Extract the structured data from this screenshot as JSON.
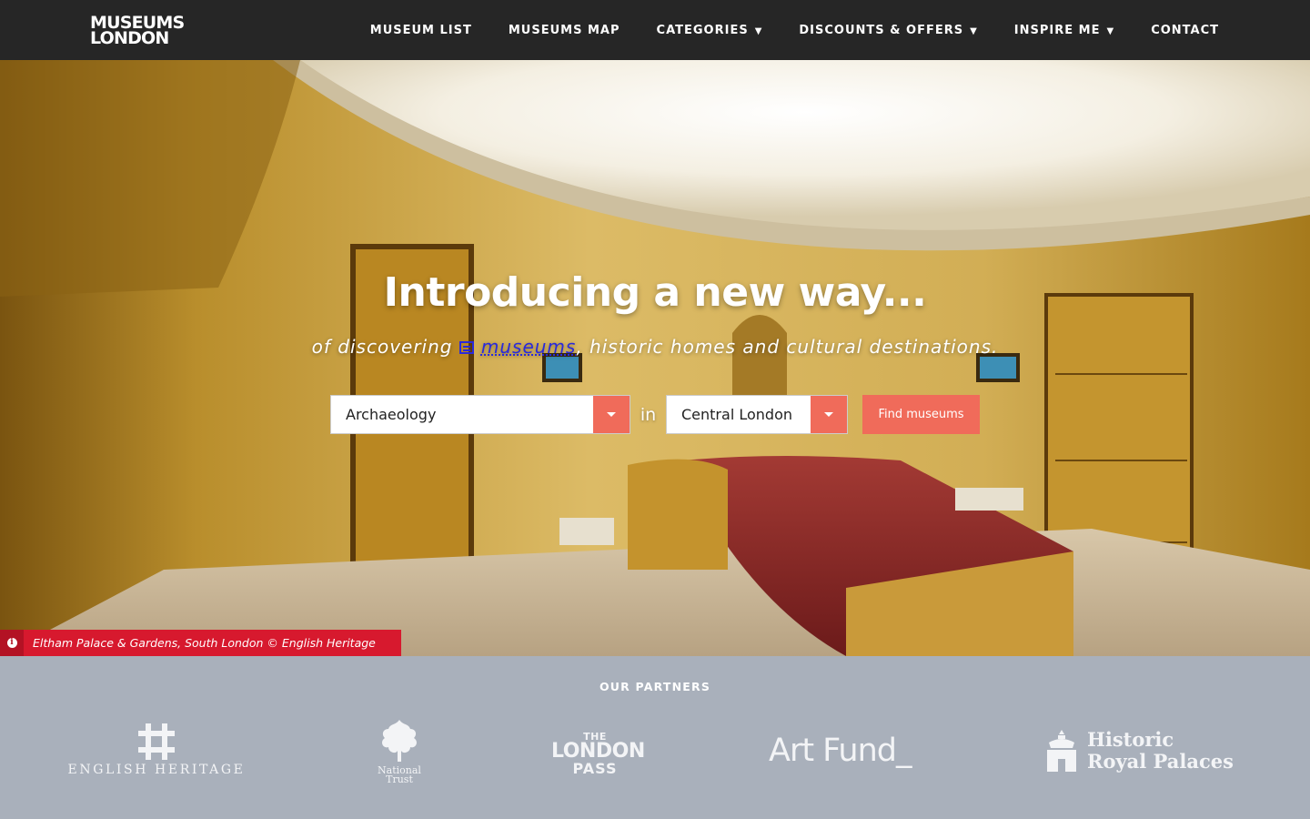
{
  "brand": {
    "logo_line1": "MUSEUMS",
    "logo_line2": "LONDON"
  },
  "nav": {
    "items": [
      {
        "label": "MUSEUM LIST",
        "has_dropdown": false
      },
      {
        "label": "MUSEUMS MAP",
        "has_dropdown": false
      },
      {
        "label": "CATEGORIES",
        "has_dropdown": true
      },
      {
        "label": "DISCOUNTS & OFFERS",
        "has_dropdown": true
      },
      {
        "label": "INSPIRE ME",
        "has_dropdown": true
      },
      {
        "label": "CONTACT",
        "has_dropdown": false
      }
    ],
    "caret": "▼"
  },
  "hero": {
    "title": "Introducing a new way...",
    "subtitle_prefix": "of discovering",
    "subtitle_link": "museums",
    "subtitle_suffix": ", historic homes and cultural destinations.",
    "search": {
      "category_value": "Archaeology",
      "in_label": "in",
      "location_value": "Central London",
      "button_label": "Find museums"
    },
    "caption": "Eltham Palace & Gardens, South London © English Heritage",
    "caption_icon": "i"
  },
  "partners": {
    "heading": "OUR PARTNERS",
    "english_heritage": "ENGLISH HERITAGE",
    "national_trust_line1": "National",
    "national_trust_line2": "Trust",
    "london_pass_line1": "THE",
    "london_pass_line2": "LONDON",
    "london_pass_line3": "PASS",
    "art_fund": "Art Fund_",
    "hrp_line1": "Historic",
    "hrp_line2": "Royal Palaces"
  },
  "colors": {
    "nav_bg": "#262626",
    "accent": "#f06b5a",
    "caption_bg": "#d7192e",
    "partners_bg": "#a9b0bb"
  }
}
